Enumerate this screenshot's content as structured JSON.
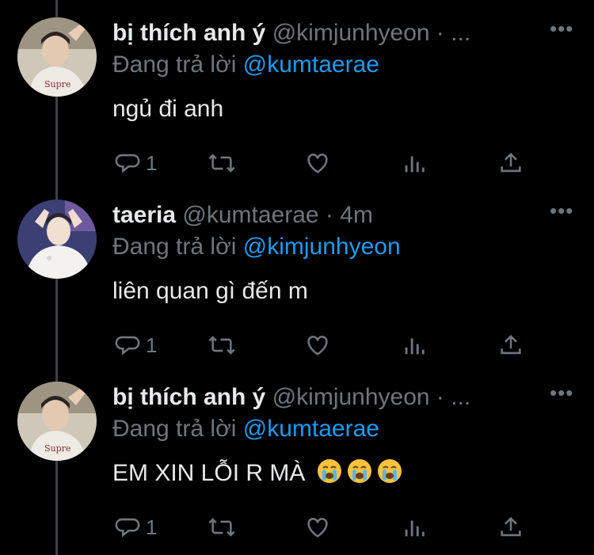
{
  "tweets": [
    {
      "display_name": "bị thích anh ý",
      "handle": "@kimjunhyeon · ...",
      "replying_prefix": "Đang trả lời",
      "replying_to": "@kumtaerae",
      "text": "ngủ đi anh",
      "reply_count": "1",
      "avatar_icon": "profile-photo"
    },
    {
      "display_name": "taeria",
      "handle": "@kumtaerae · 4m",
      "replying_prefix": "Đang trả lời",
      "replying_to": "@kimjunhyeon",
      "text": "liên quan gì đến m",
      "reply_count": "1",
      "avatar_icon": "profile-photo"
    },
    {
      "display_name": "bị thích anh ý",
      "handle": "@kimjunhyeon · ...",
      "replying_prefix": "Đang trả lời",
      "replying_to": "@kumtaerae",
      "text": "EM XIN LỖI R MÀ",
      "emoji": [
        "crying-face-emoji",
        "crying-face-emoji",
        "crying-face-emoji"
      ],
      "reply_count": "1",
      "avatar_icon": "profile-photo"
    }
  ],
  "more_label": "•••",
  "icons": {
    "reply": "speech-bubble-icon",
    "retweet": "retweet-icon",
    "like": "heart-icon",
    "analytics": "bar-chart-icon",
    "share": "share-icon",
    "more": "more-dots-icon"
  },
  "colors": {
    "background": "#000000",
    "text": "#e7e9ea",
    "muted": "#6e767d",
    "mention": "#1d9bf0",
    "thread_line": "#3e4144"
  }
}
